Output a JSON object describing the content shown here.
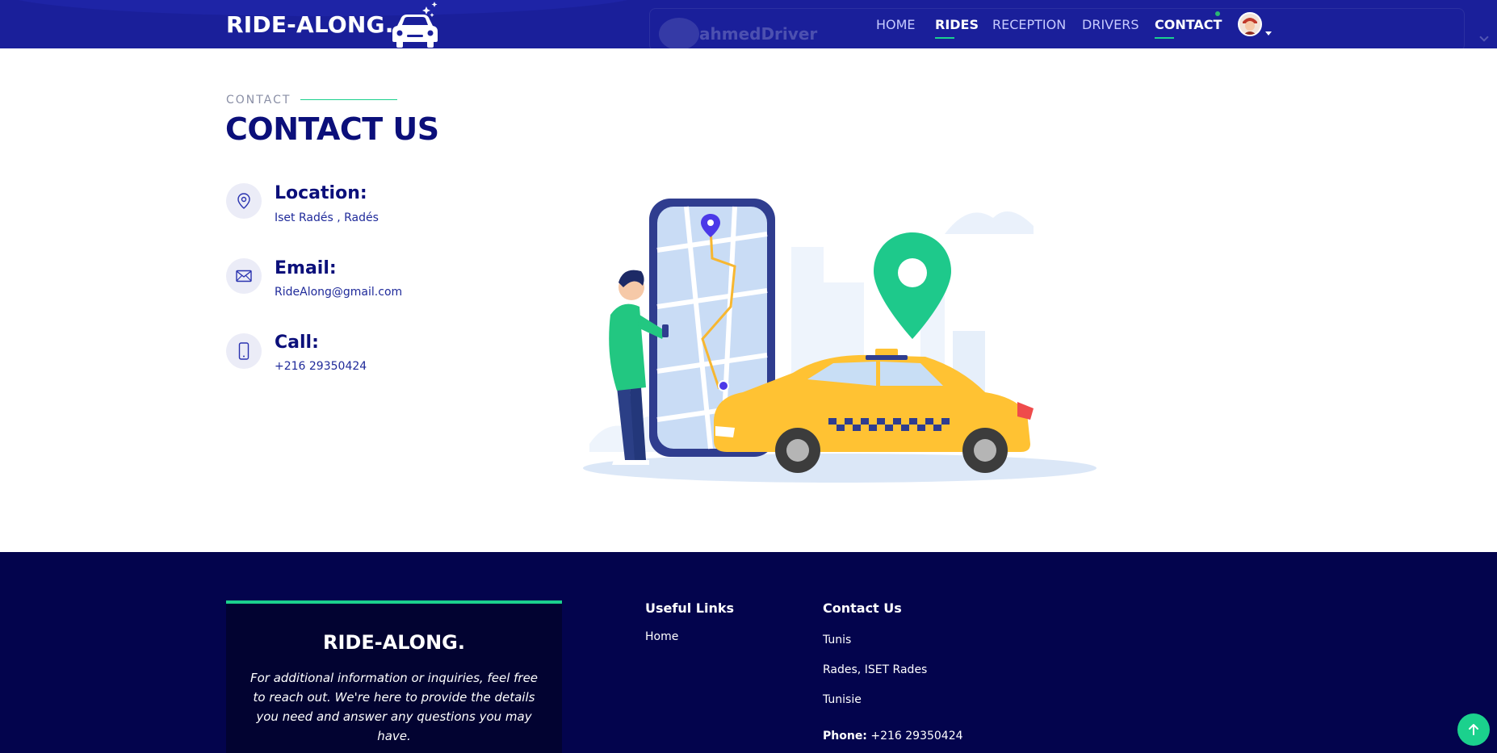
{
  "header": {
    "brand": "RIDE-ALONG.",
    "ghost_username": "ahmedDriver",
    "nav": [
      {
        "label": "HOME",
        "active": false
      },
      {
        "label": "RIDES",
        "active": true
      },
      {
        "label": "RECEPTION",
        "active": false
      },
      {
        "label": "DRIVERS",
        "active": false
      },
      {
        "label": "CONTACT",
        "active": true
      }
    ]
  },
  "contact": {
    "kicker": "CONTACT",
    "title": "CONTACT US",
    "items": [
      {
        "label": "Location:",
        "value": "Iset Radés , Radés",
        "icon": "location-pin-icon"
      },
      {
        "label": "Email:",
        "value": "RideAlong@gmail.com",
        "icon": "envelope-icon"
      },
      {
        "label": "Call:",
        "value": "+216 29350424",
        "icon": "mobile-phone-icon"
      }
    ]
  },
  "footer": {
    "about_title": "RIDE-ALONG.",
    "about_text": "For additional information or inquiries, feel free to reach out. We're here to provide the details you need and answer any questions you may have.",
    "useful_links_heading": "Useful Links",
    "useful_links": [
      "Home"
    ],
    "contact_heading": "Contact Us",
    "contact_lines": [
      "Tunis",
      "Rades, ISET Rades",
      "Tunisie"
    ],
    "phone_label": "Phone:",
    "phone_value": "+216 29350424"
  },
  "colors": {
    "header_bg": "#1a1f9a",
    "accent": "#1bd18d",
    "title": "#0b0f7a",
    "footer_bg": "#03044d",
    "taxi": "#ffc233"
  }
}
